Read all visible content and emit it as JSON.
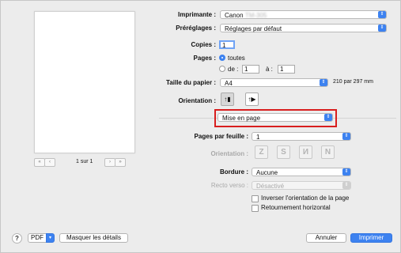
{
  "preview": {
    "page_indicator": "1 sur 1",
    "first_label": "«",
    "prev_label": "‹",
    "next_label": "›",
    "last_label": "»"
  },
  "printer": {
    "label": "Imprimante :",
    "value": "Canon",
    "value_blurred": "TM-305"
  },
  "presets": {
    "label": "Préréglages :",
    "value": "Réglages par défaut"
  },
  "copies": {
    "label": "Copies :",
    "value": "1"
  },
  "pages": {
    "label": "Pages :",
    "all_label": "toutes",
    "from_label": "de :",
    "from_value": "1",
    "to_label": "à :",
    "to_value": "1"
  },
  "paper_size": {
    "label": "Taille du papier :",
    "value": "A4",
    "dimensions": "210 par 297 mm"
  },
  "orientation": {
    "label": "Orientation :",
    "selected": "portrait"
  },
  "section_popup": {
    "value": "Mise en page"
  },
  "layout": {
    "pages_per_sheet_label": "Pages par feuille :",
    "pages_per_sheet_value": "1",
    "layout_direction_label": "Orientation :",
    "border_label": "Bordure :",
    "border_value": "Aucune",
    "two_sided_label": "Recto verso :",
    "two_sided_value": "Désactivé",
    "reverse_orientation_label": "Inverser l'orientation de la page",
    "flip_horizontal_label": "Retournement horizontal"
  },
  "footer": {
    "help_label": "?",
    "pdf_label": "PDF",
    "hide_details_label": "Masquer les détails",
    "cancel_label": "Annuler",
    "print_label": "Imprimer"
  },
  "colors": {
    "accent": "#3d82f0",
    "highlight_border": "#d81e1e"
  },
  "icons": {
    "popup_arrow": "updown-chevron-icon",
    "pdf_arrow": "chevron-down-icon"
  }
}
